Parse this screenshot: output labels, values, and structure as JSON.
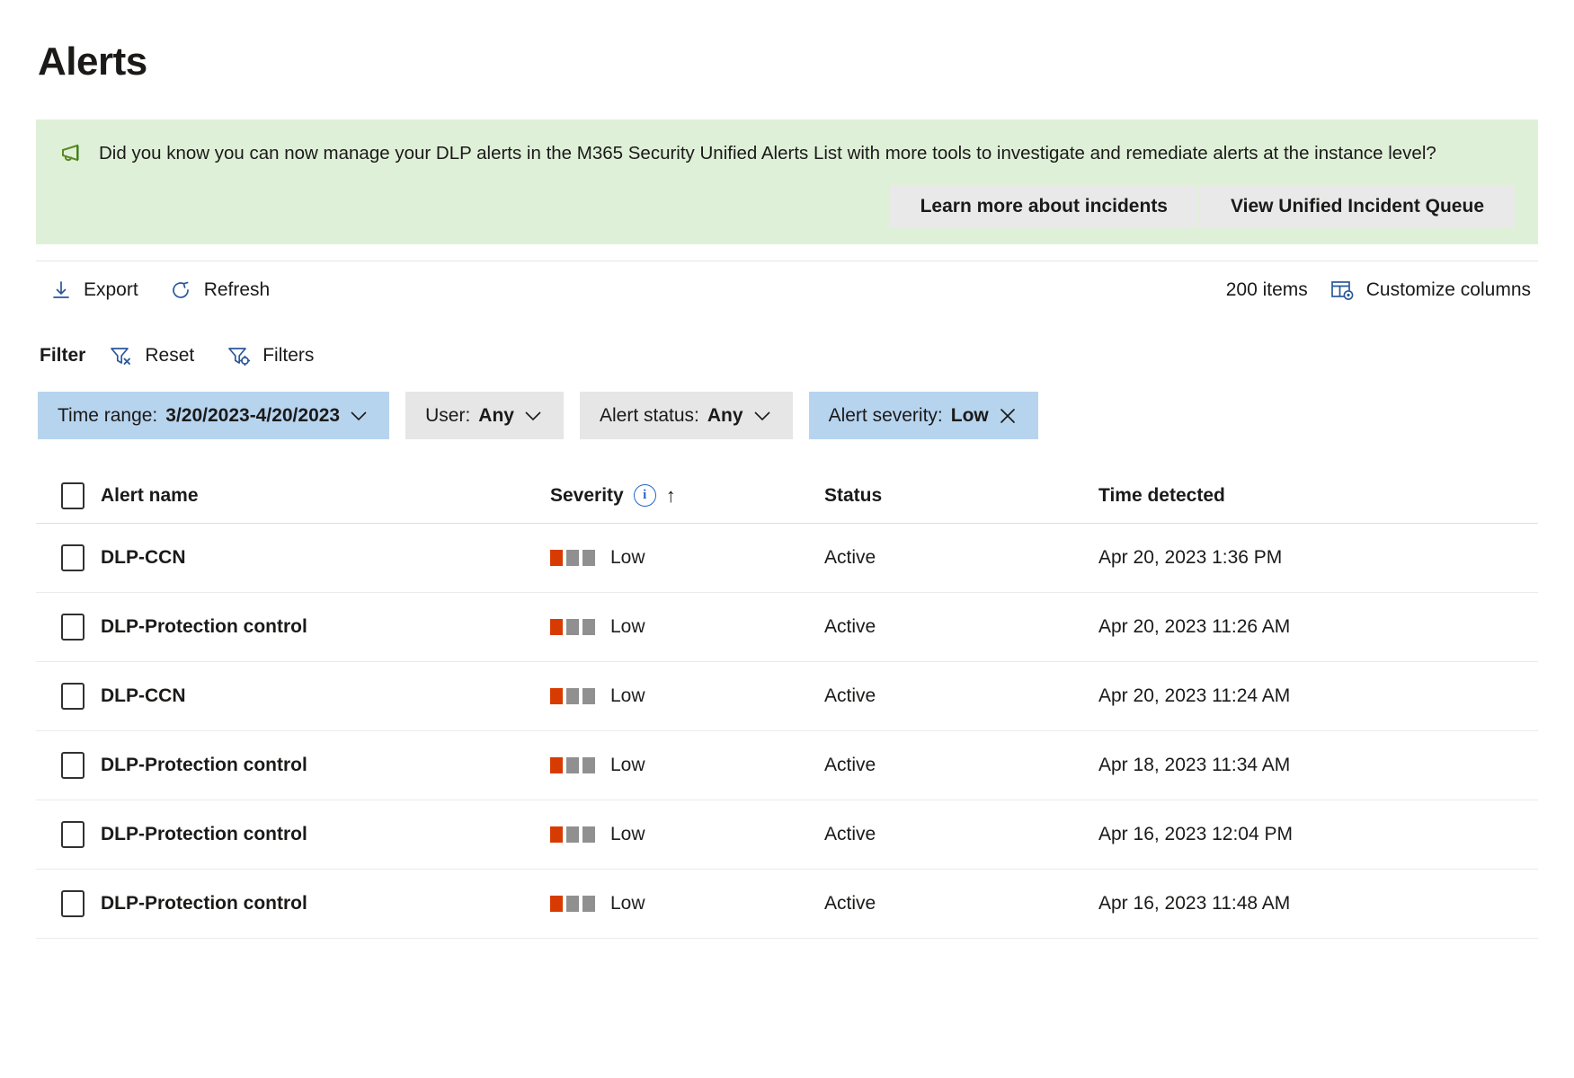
{
  "page": {
    "title": "Alerts"
  },
  "banner": {
    "icon": "megaphone-icon",
    "message": "Did you know you can now manage your DLP alerts in the M365 Security Unified Alerts List with more tools to investigate and remediate alerts at the instance level?",
    "background_color": "#dff0d8",
    "icon_color": "#3f8a1f",
    "buttons": [
      {
        "label": "Learn more about incidents",
        "name": "learn-more-about-incidents-button"
      },
      {
        "label": "View Unified Incident Queue",
        "name": "view-unified-incident-queue-button"
      }
    ]
  },
  "commandbar": {
    "export_label": "Export",
    "export_icon": "download-arrow-icon",
    "refresh_label": "Refresh",
    "refresh_icon": "refresh-icon",
    "items_count": "200 items",
    "customize_columns_label": "Customize columns",
    "customize_columns_icon": "table-settings-icon"
  },
  "filterbar": {
    "label": "Filter",
    "reset_label": "Reset",
    "reset_icon": "funnel-clear-icon",
    "filters_label": "Filters",
    "filters_icon": "funnel-settings-icon",
    "pills": [
      {
        "name": "filter-pill-time-range",
        "key": "Time range:",
        "value": "3/20/2023-4/20/2023",
        "trailing_icon": "chevron-down-icon",
        "active": true
      },
      {
        "name": "filter-pill-user",
        "key": "User:",
        "value": "Any",
        "trailing_icon": "chevron-down-icon",
        "active": false
      },
      {
        "name": "filter-pill-alert-status",
        "key": "Alert status:",
        "value": "Any",
        "trailing_icon": "chevron-down-icon",
        "active": false
      },
      {
        "name": "filter-pill-alert-severity",
        "key": "Alert severity:",
        "value": "Low",
        "trailing_icon": "close-icon",
        "active": true
      }
    ],
    "active_pill_color": "#b7d4ef",
    "inactive_pill_color": "#e6e6e6"
  },
  "table": {
    "columns": {
      "alert_name": "Alert name",
      "severity": "Severity",
      "status": "Status",
      "time_detected": "Time detected"
    },
    "severity_info_icon": "info-icon",
    "sort_icon": "sort-ascending-arrow-icon",
    "severity_colors": {
      "filled": "#d83b01",
      "empty": "#909090"
    },
    "rows": [
      {
        "alert_name": "DLP-CCN",
        "severity": "Low",
        "severity_level": 1,
        "status": "Active",
        "time_detected": "Apr 20, 2023 1:36 PM"
      },
      {
        "alert_name": "DLP-Protection control",
        "severity": "Low",
        "severity_level": 1,
        "status": "Active",
        "time_detected": "Apr 20, 2023 11:26 AM"
      },
      {
        "alert_name": "DLP-CCN",
        "severity": "Low",
        "severity_level": 1,
        "status": "Active",
        "time_detected": "Apr 20, 2023 11:24 AM"
      },
      {
        "alert_name": "DLP-Protection control",
        "severity": "Low",
        "severity_level": 1,
        "status": "Active",
        "time_detected": "Apr 18, 2023 11:34 AM"
      },
      {
        "alert_name": "DLP-Protection control",
        "severity": "Low",
        "severity_level": 1,
        "status": "Active",
        "time_detected": "Apr 16, 2023 12:04 PM"
      },
      {
        "alert_name": "DLP-Protection control",
        "severity": "Low",
        "severity_level": 1,
        "status": "Active",
        "time_detected": "Apr 16, 2023 11:48 AM"
      }
    ]
  }
}
